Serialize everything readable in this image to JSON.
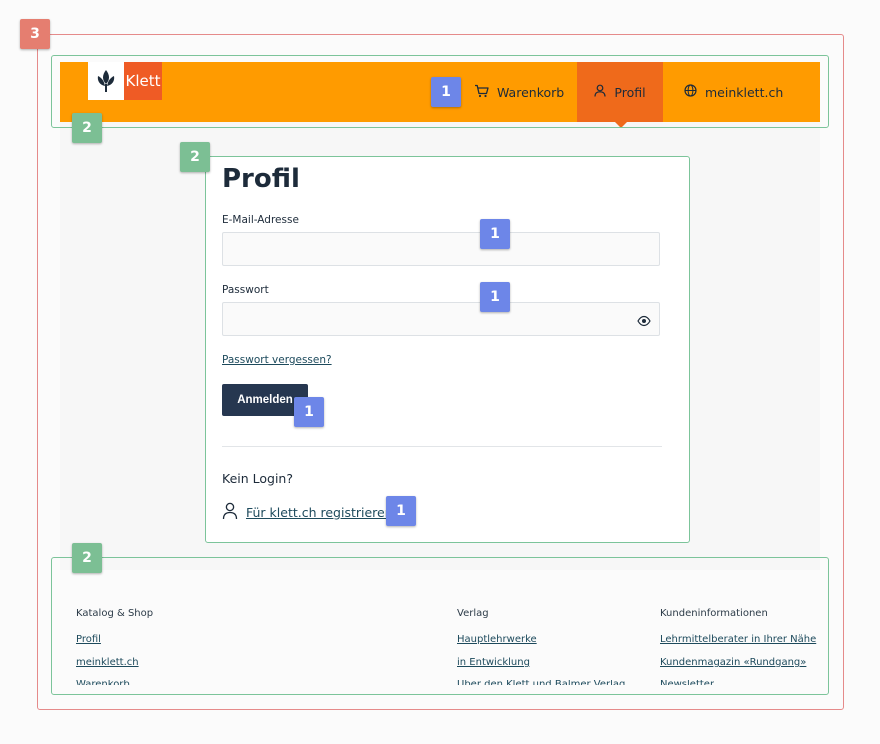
{
  "annotations": {
    "outer_badge": "3",
    "group_badges": [
      "2",
      "2",
      "2"
    ],
    "interactive_badges": [
      "1",
      "1",
      "1",
      "1",
      "1"
    ]
  },
  "header": {
    "logo_text": "Klett",
    "nav": {
      "cart": "Warenkorb",
      "profile": "Profil",
      "meinklett": "meinklett.ch"
    },
    "brand_color": "#ff9b00",
    "active_color": "#ef6a1b"
  },
  "login": {
    "title": "Profil",
    "email_label": "E-Mail-Adresse",
    "email_value": "",
    "password_label": "Passwort",
    "password_value": "",
    "forgot_link": "Passwort vergessen?",
    "submit_button": "Anmelden",
    "no_login_heading": "Kein Login?",
    "register_link": "Für klett.ch registrieren"
  },
  "footer": {
    "columns": [
      {
        "heading": "Katalog & Shop",
        "links": [
          "Profil",
          "meinklett.ch"
        ],
        "cut_link": "Warenkorb"
      },
      {
        "heading": "Verlag",
        "links": [
          "Hauptlehrwerke",
          "in Entwicklung"
        ],
        "cut_link": "Über den Klett und Balmer Verlag"
      },
      {
        "heading": "Kundeninformationen",
        "links": [
          "Lehrmittelberater in Ihrer Nähe",
          "Kundenmagazin «Rundgang»"
        ],
        "cut_link": "Newsletter"
      }
    ]
  }
}
